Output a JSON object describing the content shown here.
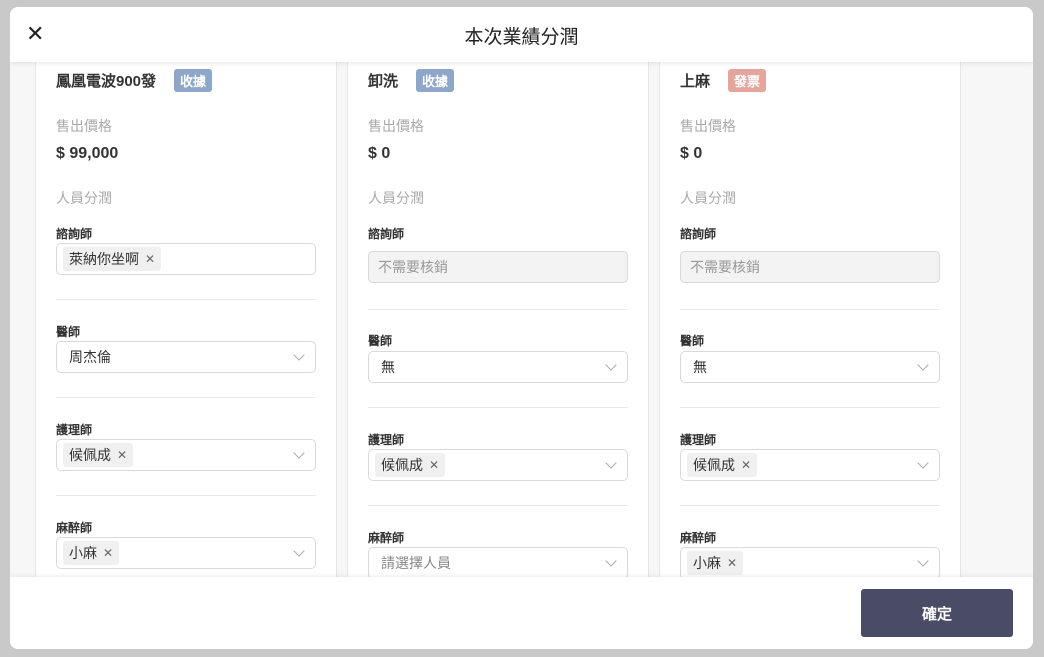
{
  "dialog": {
    "title": "本次業績分潤",
    "confirm_label": "確定"
  },
  "labels": {
    "price": "售出價格",
    "split": "人員分潤",
    "consultant": "諮詢師",
    "doctor": "醫師",
    "nurse": "護理師",
    "anesthetist": "麻醉師"
  },
  "colors": {
    "receipt": "#8ea6c8",
    "invoice": "#e4a59c",
    "confirm": "#4a4c66"
  },
  "cards": [
    {
      "name": "鳳凰電波900發",
      "badge": "收據",
      "price": "$ 99,000",
      "consultant": "萊納你坐啊",
      "doctor": "周杰倫",
      "nurse": "候佩成",
      "anesthetist": "小麻"
    },
    {
      "name": "卸洗",
      "badge": "收據",
      "price": "$ 0",
      "consultant": "不需要核銷",
      "doctor": "無",
      "nurse": "候佩成",
      "anesthetist": "請選擇人員"
    },
    {
      "name": "上麻",
      "badge": "發票",
      "price": "$ 0",
      "consultant": "不需要核銷",
      "doctor": "無",
      "nurse": "候佩成",
      "anesthetist": "小麻"
    }
  ]
}
